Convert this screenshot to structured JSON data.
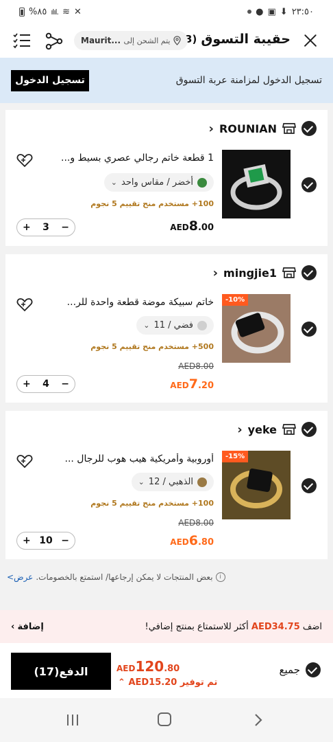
{
  "status_bar": {
    "time": "٢٣:٥٠",
    "battery": "%٨٥"
  },
  "header": {
    "title": "حقيبة التسوق",
    "count": "(3)",
    "ship_label": "يتم الشحن إلى",
    "ship_dest": "Maurit..."
  },
  "login_banner": {
    "text": "تسجيل الدخول لمزامنة عربة التسوق",
    "button": "تسجيل الدخول"
  },
  "stores": [
    {
      "name": "ROUNIAN",
      "item": {
        "title": "1 قطعة خاتم رجالي عصري بسيط و...",
        "variant": "أخضر / مقاس واحد",
        "swatch": "#3a8a3e",
        "rating": "100+ مستخدم منح تقييم 5 نجوم",
        "old_price": "",
        "price_cur": "AED",
        "price_int": "8",
        "price_dec": ".00",
        "qty": "3",
        "discount": ""
      }
    },
    {
      "name": "mingjie1",
      "item": {
        "title": "خاتم سبيكة موضة قطعة واحدة للر...",
        "variant": "فضي / 11",
        "swatch": "#cfcfcf",
        "rating": "500+ مستخدم منح تقييم 5 نجوم",
        "old_price": "AED8.00",
        "price_cur": "AED",
        "price_int": "7",
        "price_dec": ".20",
        "qty": "4",
        "discount": "-10%"
      }
    },
    {
      "name": "yeke",
      "item": {
        "title": "أوروبية وأمريكية هيب هوب للرجال ...",
        "variant": "الذهبي / 12",
        "swatch": "#9a7a45",
        "rating": "100+ مستخدم منح تقييم 5 نجوم",
        "old_price": "AED8.00",
        "price_cur": "AED",
        "price_int": "6",
        "price_dec": ".80",
        "qty": "10",
        "discount": "-15%"
      }
    }
  ],
  "notice": {
    "text": "بعض المنتجات لا يمكن إرجاعها/ استمتع بالخصومات.",
    "link": "عرض>"
  },
  "add_more": {
    "prefix": "اضف",
    "amount": "AED34.75",
    "suffix": "أكثر للاستمتاع بمنتج إضافي!",
    "link": "إضافة"
  },
  "checkout": {
    "all_label": "جميع",
    "total_cur": "AED",
    "total_int": "120",
    "total_dec": ".80",
    "saving": "تم توفير AED15.20",
    "pay_button": "الدفع(17)"
  },
  "colors": {
    "accent": "#ff6a1a",
    "banner_bg": "#dbe9f7",
    "addmore_bg": "#fdeeee"
  }
}
